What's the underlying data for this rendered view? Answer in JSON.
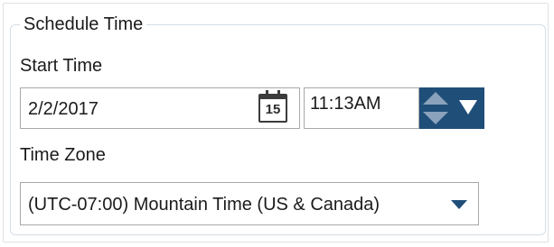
{
  "group": {
    "title": "Schedule Time"
  },
  "start_time": {
    "label": "Start Time",
    "date_value": "2/2/2017",
    "calendar_icon": "calendar-icon",
    "calendar_day": "15",
    "time_value": "11:13AM"
  },
  "time_zone": {
    "label": "Time Zone",
    "selected": "(UTC-07:00) Mountain Time (US & Canada)"
  },
  "colors": {
    "spinner": "#1f4e79",
    "spinner_arrow": "#8aa2bb",
    "border": "#a8a8a8"
  }
}
